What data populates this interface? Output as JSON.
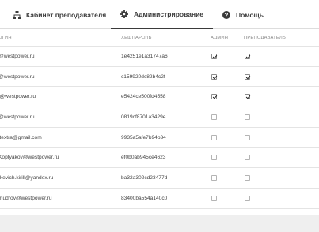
{
  "tabs": [
    {
      "label": "Кабинет преподавателя",
      "icon": "sitemap-icon",
      "active": false
    },
    {
      "label": "Администрирование",
      "icon": "gear-icon",
      "active": true
    },
    {
      "label": "Помощь",
      "icon": "question-circle-icon",
      "active": false
    }
  ],
  "table": {
    "headers": {
      "login": "ОГИН",
      "hash": "ХЕШПАРОЛЬ",
      "admin": "АДМИН",
      "teacher": "ПРЕПОДАВАТЕЛЬ"
    },
    "rows": [
      {
        "login": "@westpower.ru",
        "hash": "1e4251e1a31747a6",
        "admin": true,
        "teacher": true
      },
      {
        "login": "@westpower.ru",
        "hash": "c159920dc82b4c2f",
        "admin": true,
        "teacher": true
      },
      {
        "login": "l@westpower.ru",
        "hash": "e5424ce500fd4558",
        "admin": true,
        "teacher": true
      },
      {
        "login": "@westpower.ru",
        "hash": "0819cf8701a3429e",
        "admin": false,
        "teacher": false
      },
      {
        "login": "ltextra@gmail.com",
        "hash": "9935a5afe7b94b34",
        "admin": false,
        "teacher": false
      },
      {
        "login": "Koptyakov@westpower.ru",
        "hash": "ef0b0ab945ce4623",
        "admin": false,
        "teacher": false
      },
      {
        "login": "tkevich.kirill@yandex.ru",
        "hash": "ba32a302cd23477d",
        "admin": false,
        "teacher": false
      },
      {
        "login": "mudrov@westpower.ru",
        "hash": "83400ba554a140c0",
        "admin": false,
        "teacher": false
      }
    ]
  },
  "colors": {
    "accent": "#3a3a3a",
    "border": "#e4e4e4",
    "footer": "#efefef"
  }
}
